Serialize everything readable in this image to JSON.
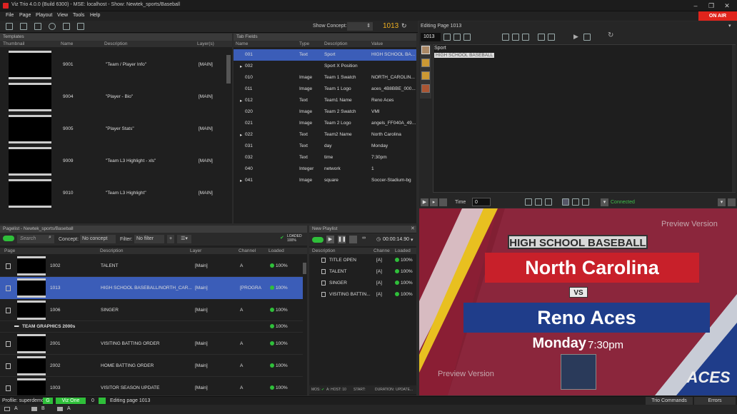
{
  "app": {
    "title": "Viz Trio 4.0.0 (Build 6300) - MSE: localhost - Show: Newtek_sports/Baseball",
    "on_air": "ON AIR"
  },
  "menu": [
    "File",
    "Page",
    "Playout",
    "View",
    "Tools",
    "Help"
  ],
  "toolbar": {
    "show_concept_label": "Show Concept:",
    "page_number": "1013"
  },
  "templates": {
    "title": "Templates",
    "columns": [
      "Thumbnail",
      "Name",
      "Description",
      "Layer(s)"
    ],
    "rows": [
      {
        "name": "9001",
        "description": "\"Team / Player Info\"",
        "layer": "[MAIN]"
      },
      {
        "name": "9004",
        "description": "\"Player - Bio\"",
        "layer": "[MAIN]"
      },
      {
        "name": "9005",
        "description": "\"Player Stats\"",
        "layer": "[MAIN]"
      },
      {
        "name": "9009",
        "description": "\"Team L3 Highlight - xls\"",
        "layer": "[MAIN]"
      },
      {
        "name": "9010",
        "description": "\"Team L3 Highlight\"",
        "layer": "[MAIN]"
      }
    ]
  },
  "tabfields": {
    "title": "Tab Fields",
    "columns": [
      "Name",
      "Type",
      "Description",
      "Value"
    ],
    "rows": [
      {
        "expand": "",
        "name": "001",
        "type": "Text",
        "description": "Sport",
        "value": "HIGH SCHOOL BA..."
      },
      {
        "expand": "▸",
        "name": "002",
        "type": "",
        "description": "Sport X Position",
        "value": ""
      },
      {
        "expand": "",
        "name": "010",
        "type": "Image",
        "description": "Team 1 Swatch",
        "value": "NORTH_CAROLIN..."
      },
      {
        "expand": "",
        "name": "011",
        "type": "Image",
        "description": "Team 1 Logo",
        "value": "aces_4B8BBE_000..."
      },
      {
        "expand": "▸",
        "name": "012",
        "type": "Text",
        "description": "Team1 Name",
        "value": "Reno Aces"
      },
      {
        "expand": "",
        "name": "020",
        "type": "Image",
        "description": "Team 2 Swatch",
        "value": "VMI"
      },
      {
        "expand": "",
        "name": "021",
        "type": "Image",
        "description": "Team 2 Logo",
        "value": "angels_FF040A_49..."
      },
      {
        "expand": "▸",
        "name": "022",
        "type": "Text",
        "description": "Team2 Name",
        "value": "North Carolina"
      },
      {
        "expand": "",
        "name": "031",
        "type": "Text",
        "description": "day",
        "value": "Monday"
      },
      {
        "expand": "",
        "name": "032",
        "type": "Text",
        "description": "time",
        "value": "7:30pm"
      },
      {
        "expand": "",
        "name": "040",
        "type": "Integer",
        "description": "network",
        "value": "1"
      },
      {
        "expand": "▸",
        "name": "041",
        "type": "Image",
        "description": "square",
        "value": "Soccer-Stadium-bg"
      }
    ]
  },
  "editing": {
    "title": "Editing Page 1013",
    "page": "1013",
    "field_label": "Sport",
    "field_value": "HIGH SCHOOL BASEBALL"
  },
  "pagelist": {
    "title": "Pagelist - Newtek_sports/Baseball",
    "search_placeholder": "Search",
    "concept_label": "Concept:",
    "concept_value": "No concept",
    "filter_label": "Filter:",
    "filter_value": "No filter",
    "loaded_badge": "LOADED 100%",
    "columns": [
      "Page",
      "Description",
      "Layer",
      "Channel",
      "Loaded"
    ],
    "rows": [
      {
        "page": "1002",
        "description": "TALENT",
        "layer": "[Main]",
        "channel": "A",
        "loaded": "100%"
      },
      {
        "page": "1013",
        "description": "HIGH SCHOOL BASEBALL/NORTH_CAR...",
        "layer": "[Main]",
        "channel": "[PROGRA",
        "loaded": "100%"
      },
      {
        "page": "1006",
        "description": "SINGER",
        "layer": "[Main]",
        "channel": "A",
        "loaded": "100%"
      },
      {
        "page": "",
        "description": "TEAM GRAPHICS 2000s",
        "layer": "",
        "channel": "",
        "loaded": "100%"
      },
      {
        "page": "2001",
        "description": "VISITING BATTING ORDER",
        "layer": "[Main]",
        "channel": "A",
        "loaded": "100%"
      },
      {
        "page": "2002",
        "description": "HOME BATTING ORDER",
        "layer": "[Main]",
        "channel": "A",
        "loaded": "100%"
      },
      {
        "page": "1003",
        "description": "VISITOR SEASON UPDATE",
        "layer": "[Main]",
        "channel": "A",
        "loaded": "100%"
      }
    ]
  },
  "playlist": {
    "title": "New Playlist",
    "time": "00:00:14.90",
    "columns": [
      "Description",
      "Channe",
      "Loaded"
    ],
    "rows": [
      {
        "description": "TITLE OPEN",
        "channel": "[A]",
        "loaded": "100%"
      },
      {
        "description": "TALENT",
        "channel": "[A]",
        "loaded": "100%"
      },
      {
        "description": "SINGER",
        "channel": "[A]",
        "loaded": "100%"
      },
      {
        "description": "VISITING BATTIN...",
        "channel": "[A]",
        "loaded": "100%"
      }
    ],
    "footer": {
      "mos": "MOS:",
      "host": "A: HOST: 10",
      "start": "START:",
      "duration": "DURATION:",
      "update": "UPDATE..."
    }
  },
  "preview_controls": {
    "time_label": "Time",
    "time_value": "0",
    "status": "Connected"
  },
  "preview": {
    "sport": "HIGH SCHOOL BASEBALL",
    "team1": "North Carolina",
    "vs": "VS",
    "team2": "Reno Aces",
    "day": "Monday",
    "time": "7:30pm",
    "watermark": "Preview Version",
    "logo_text": "ACES"
  },
  "status": {
    "profile": "Profile: superdemo",
    "g": "G",
    "viz": "Viz One",
    "count": "0",
    "editing": "Editing page 1013",
    "trio_commands": "Trio Commands",
    "errors": "Errors"
  },
  "bottom": {
    "a1": "A",
    "b": "B",
    "a2": "A"
  },
  "colors": {
    "accent": "#3b5db8",
    "onair": "#e0241c",
    "ok": "#2fbf3a",
    "brand_red": "#c8202a",
    "brand_blue": "#1f3d8a"
  }
}
